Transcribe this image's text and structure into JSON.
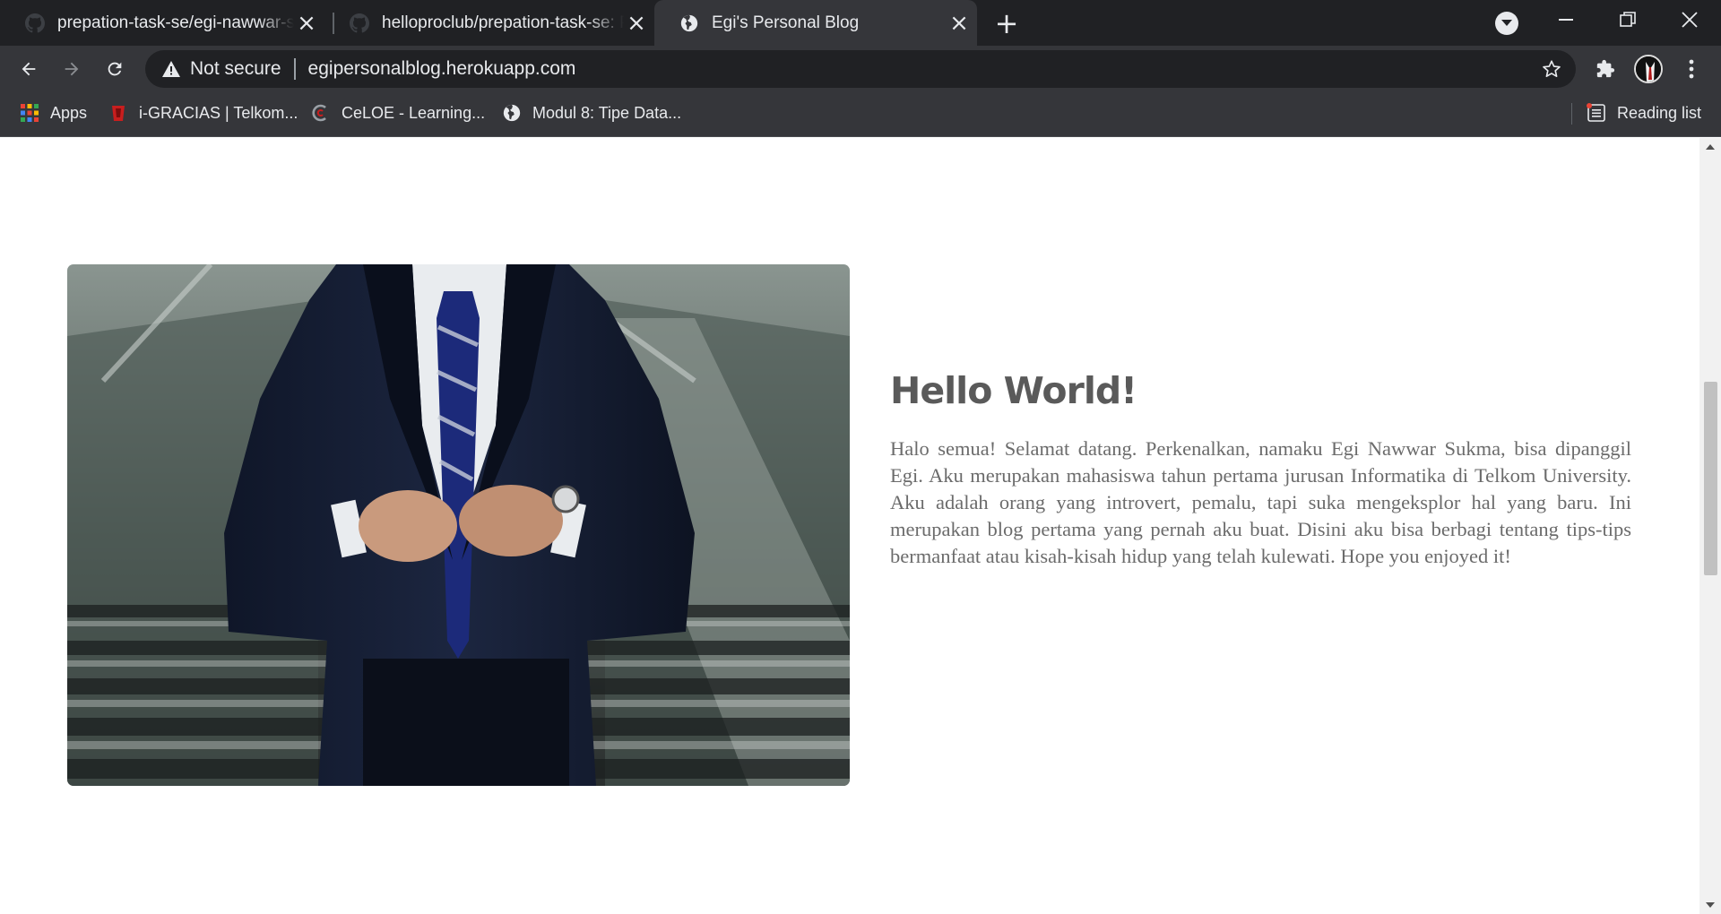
{
  "browser": {
    "tabs": [
      {
        "title": "prepation-task-se/egi-nawwar-sukma",
        "icon": "github-icon",
        "active": false
      },
      {
        "title": "helloproclub/prepation-task-se: Prepation",
        "icon": "github-icon",
        "active": false
      },
      {
        "title": "Egi's Personal Blog",
        "icon": "globe-icon",
        "active": true
      }
    ],
    "omnibox": {
      "security_label": "Not secure",
      "url": "egipersonalblog.herokuapp.com"
    },
    "bookmarks": [
      {
        "label": "Apps",
        "icon": "apps-grid-icon"
      },
      {
        "label": "i-GRACIAS | Telkom...",
        "icon": "telkom-icon"
      },
      {
        "label": "CeLOE - Learning...",
        "icon": "celoe-icon"
      },
      {
        "label": "Modul 8: Tipe Data...",
        "icon": "globe-icon"
      }
    ],
    "reading_list_label": "Reading list"
  },
  "page": {
    "title": "Hello World!",
    "body": "Halo semua! Selamat datang. Perkenalkan, namaku Egi Nawwar Sukma, bisa dipanggil Egi. Aku merupakan mahasiswa tahun pertama jurusan Informatika di Telkom University. Aku adalah orang yang introvert, pemalu, tapi suka mengeksplor hal yang baru. Ini merupakan blog pertama yang pernah aku buat. Disini aku bisa berbagi tentang tips-tips bermanfaat atau kisah-kisah hidup yang telah kulewati. Hope you enjoyed it!",
    "image_subject": "man-in-suit-photo"
  },
  "colors": {
    "tabstrip": "#202124",
    "toolbar": "#35363a",
    "heading": "#5a5a5a",
    "body_text": "#6b6b6b"
  }
}
